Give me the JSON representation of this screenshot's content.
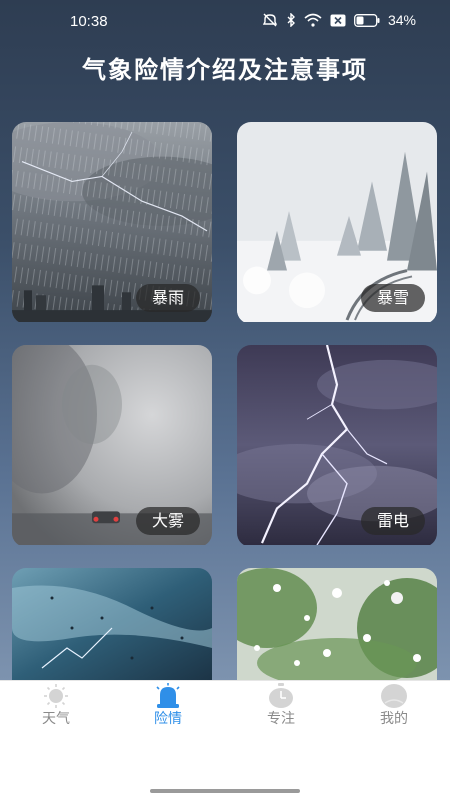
{
  "status_bar": {
    "time": "10:38",
    "battery_percent": "34%",
    "icons": [
      "mute-icon",
      "bluetooth-icon",
      "wifi-icon",
      "sim-x-icon",
      "battery-icon"
    ]
  },
  "page": {
    "title": "气象险情介绍及注意事项"
  },
  "cards": [
    {
      "label": "暴雨",
      "image": "rainstorm"
    },
    {
      "label": "暴雪",
      "image": "snowstorm"
    },
    {
      "label": "大雾",
      "image": "fog"
    },
    {
      "label": "雷电",
      "image": "lightning"
    },
    {
      "label": "",
      "image": "storm-sea"
    },
    {
      "label": "",
      "image": "hail"
    }
  ],
  "nav": {
    "items": [
      {
        "label": "天气",
        "icon": "sun-icon",
        "active": false
      },
      {
        "label": "险情",
        "icon": "siren-icon",
        "active": true
      },
      {
        "label": "专注",
        "icon": "timer-icon",
        "active": false
      },
      {
        "label": "我的",
        "icon": "profile-icon",
        "active": false
      }
    ],
    "active_color": "#2f8fe8",
    "inactive_color": "#8a8a8a"
  }
}
